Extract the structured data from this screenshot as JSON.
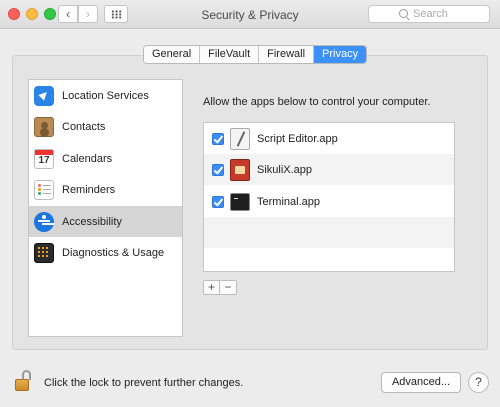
{
  "window": {
    "title": "Security & Privacy",
    "search_placeholder": "Search",
    "back_glyph": "‹",
    "forward_glyph": "›"
  },
  "tabs": [
    {
      "label": "General",
      "active": false
    },
    {
      "label": "FileVault",
      "active": false
    },
    {
      "label": "Firewall",
      "active": false
    },
    {
      "label": "Privacy",
      "active": true
    }
  ],
  "sidebar": {
    "items": [
      {
        "label": "Location Services",
        "icon": "location-arrow-icon",
        "selected": false
      },
      {
        "label": "Contacts",
        "icon": "contacts-book-icon",
        "selected": false
      },
      {
        "label": "Calendars",
        "icon": "calendar-icon",
        "selected": false,
        "icon_text": "17"
      },
      {
        "label": "Reminders",
        "icon": "reminders-list-icon",
        "selected": false
      },
      {
        "label": "Accessibility",
        "icon": "accessibility-icon",
        "selected": true
      },
      {
        "label": "Diagnostics & Usage",
        "icon": "diagnostics-grid-icon",
        "selected": false
      }
    ]
  },
  "main": {
    "instruction": "Allow the apps below to control your computer.",
    "apps": [
      {
        "label": "Script Editor.app",
        "checked": true,
        "icon": "script-editor-icon"
      },
      {
        "label": "SikuliX.app",
        "checked": true,
        "icon": "sikulix-icon"
      },
      {
        "label": "Terminal.app",
        "checked": true,
        "icon": "terminal-icon"
      }
    ],
    "add_label": "+",
    "remove_label": "−"
  },
  "footer": {
    "lock_text": "Click the lock to prevent further changes.",
    "advanced_label": "Advanced...",
    "help_label": "?"
  },
  "colors": {
    "accent": "#3c91f7",
    "selected_row": "#d5d5d5",
    "window_bg": "#ececec"
  }
}
